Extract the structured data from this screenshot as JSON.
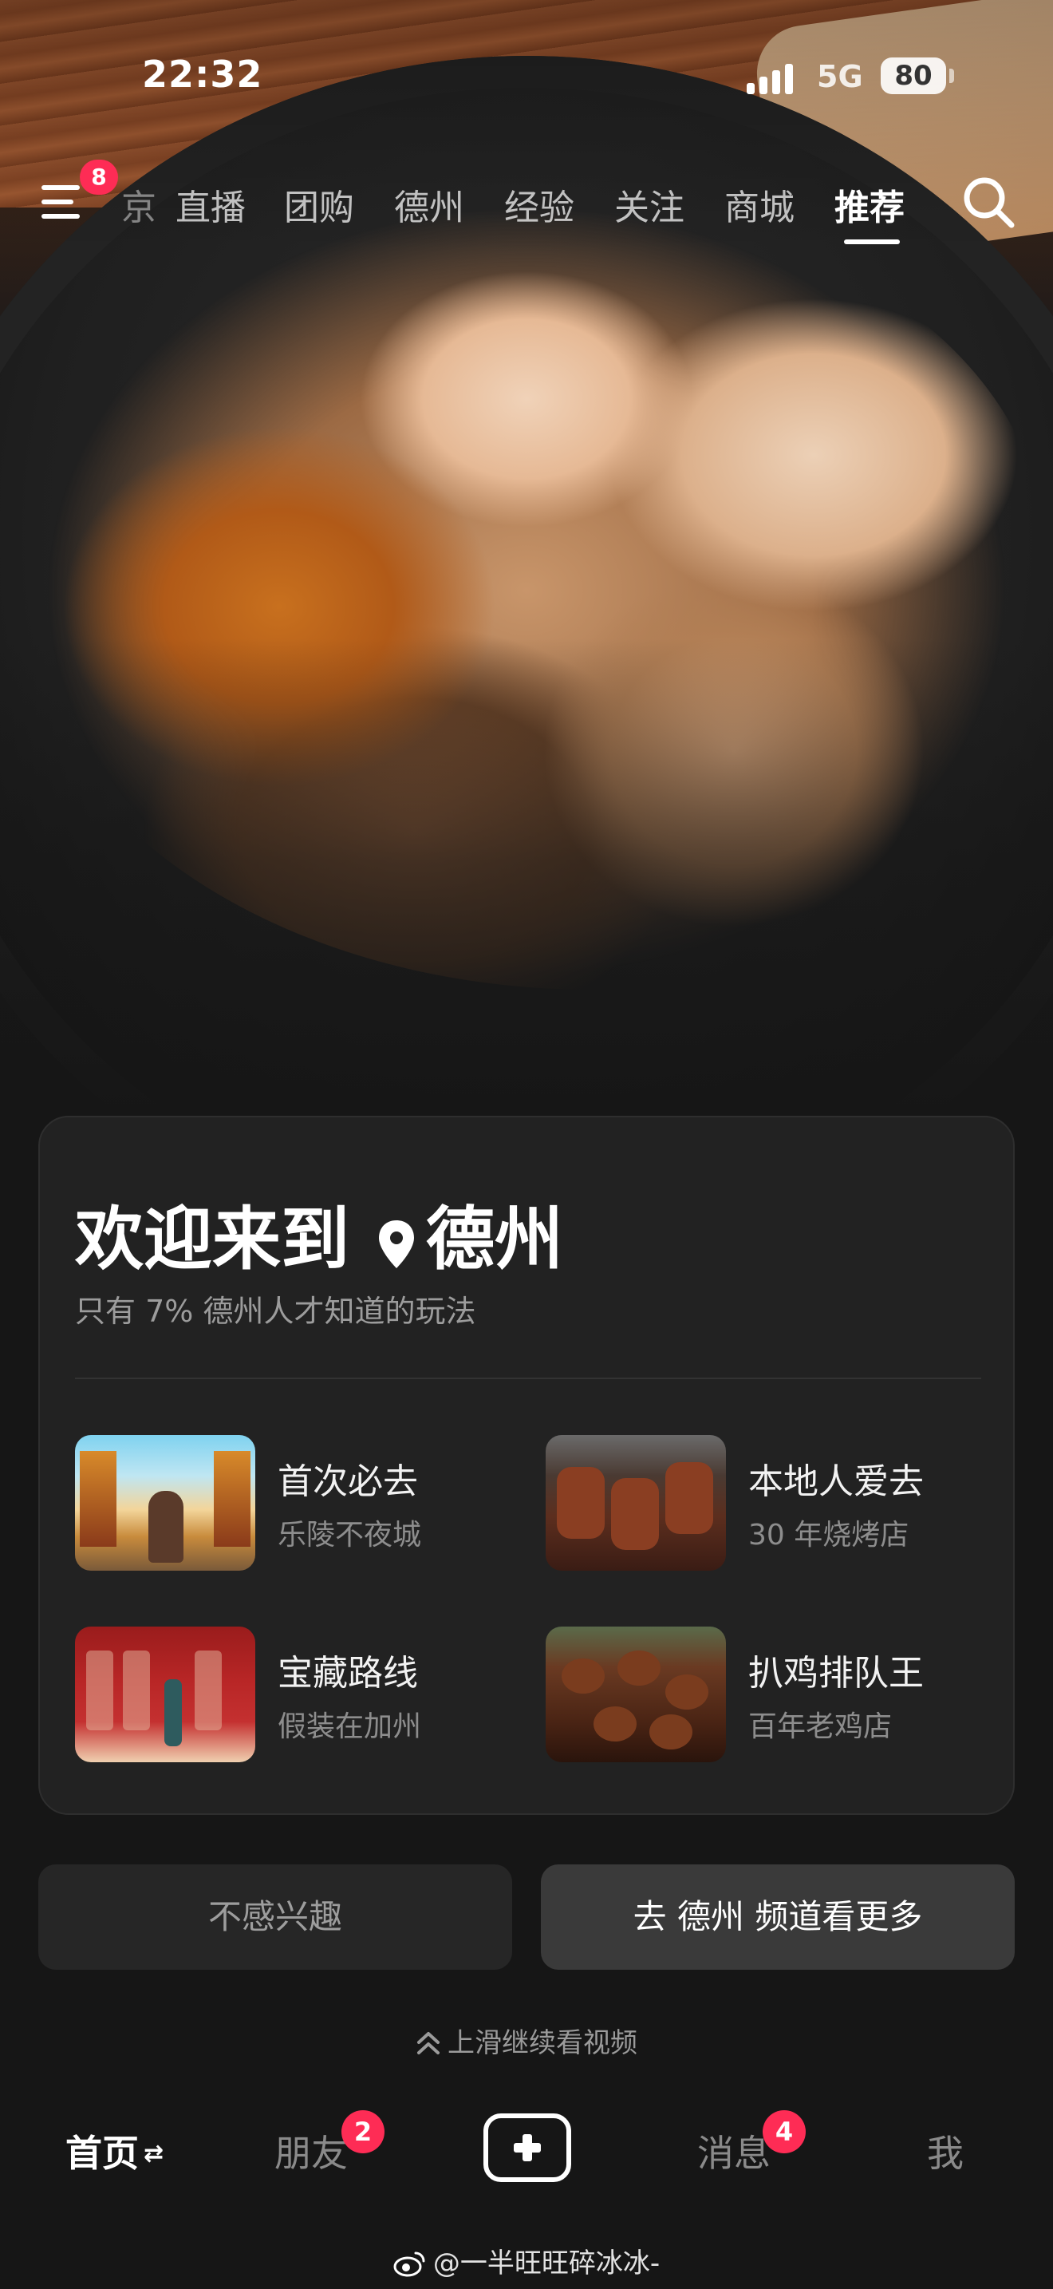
{
  "status_bar": {
    "time": "22:32",
    "network": "5G",
    "battery": "80"
  },
  "top_tabs": {
    "menu_badge": "8",
    "items": [
      {
        "label": "京",
        "state": "cut"
      },
      {
        "label": "直播",
        "state": "normal"
      },
      {
        "label": "团购",
        "state": "normal"
      },
      {
        "label": "德州",
        "state": "normal"
      },
      {
        "label": "经验",
        "state": "normal"
      },
      {
        "label": "关注",
        "state": "normal"
      },
      {
        "label": "商城",
        "state": "normal"
      },
      {
        "label": "推荐",
        "state": "active"
      }
    ]
  },
  "welcome_card": {
    "title_prefix": "欢迎来到",
    "city": "德州",
    "subtitle": "只有 7% 德州人才知道的玩法",
    "tiles": [
      {
        "title": "首次必去",
        "subtitle": "乐陵不夜城"
      },
      {
        "title": "本地人爱去",
        "subtitle": "30 年烧烤店"
      },
      {
        "title": "宝藏路线",
        "subtitle": "假装在加州"
      },
      {
        "title": "扒鸡排队王",
        "subtitle": "百年老鸡店"
      }
    ]
  },
  "actions": {
    "dismiss": "不感兴趣",
    "more": "去 德州 频道看更多"
  },
  "swipe_hint": "上滑继续看视频",
  "bottom_nav": {
    "home": "首页",
    "friends": "朋友",
    "friends_badge": "2",
    "messages": "消息",
    "messages_badge": "4",
    "me": "我"
  },
  "watermark": "@一半旺旺碎冰冰-",
  "colors": {
    "badge": "#fe2c55",
    "card_bg": "#222222",
    "page_bg": "#161616"
  }
}
